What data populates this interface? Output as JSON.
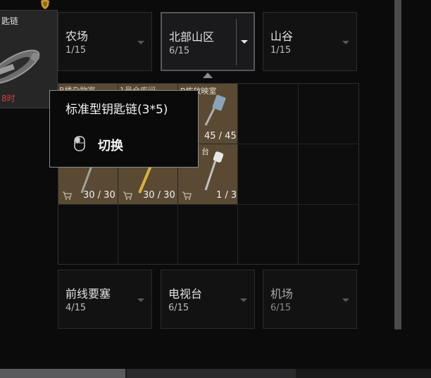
{
  "key_card": {
    "name": "匙链",
    "time": "8时"
  },
  "regions_top": [
    {
      "name": "农场",
      "count": "1/15"
    },
    {
      "name": "北部山区",
      "count": "6/15"
    },
    {
      "name": "山谷",
      "count": "1/15"
    }
  ],
  "regions_bottom": [
    {
      "name": "前线要塞",
      "count": "4/15"
    },
    {
      "name": "电视台",
      "count": "6/15"
    },
    {
      "name": "机场",
      "count": "6/15"
    }
  ],
  "grid": {
    "cell_labels": [
      "B楼杂物室",
      "1号仓库间",
      "B栋放映室",
      "台"
    ],
    "counts": [
      "45 / 45",
      "30 / 30",
      "30 / 30",
      "1 / 3"
    ]
  },
  "tooltip": {
    "title": "标准型钥匙链(3*5)",
    "action": "切换"
  },
  "colors": {
    "tan_slot": "#5a4a33",
    "timer_red": "#d04040",
    "selected_border": "#55575a"
  }
}
